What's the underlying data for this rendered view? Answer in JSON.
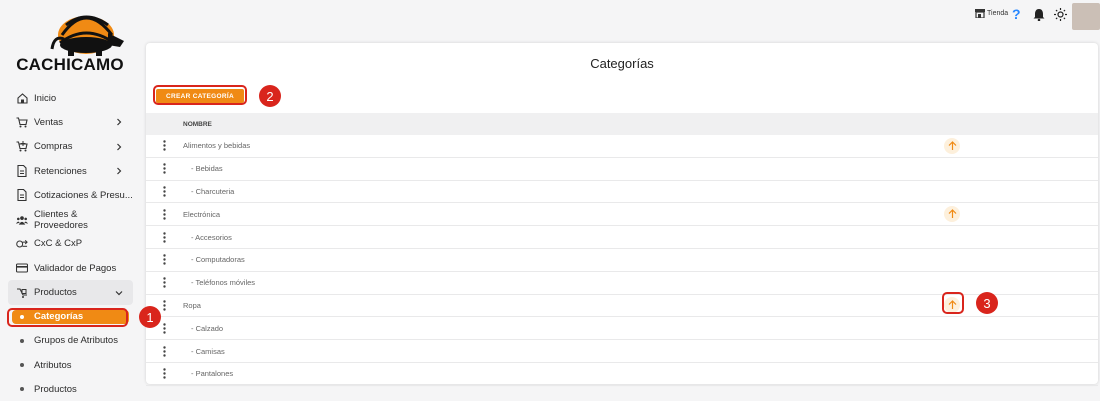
{
  "app": {
    "brand": "CACHICAMO"
  },
  "topbar": {
    "store_label": "Tienda",
    "help_label": "?"
  },
  "sidebar": {
    "items": [
      {
        "label": "Inicio",
        "icon": "home-icon",
        "has_chevron": false
      },
      {
        "label": "Ventas",
        "icon": "cart-icon",
        "has_chevron": true
      },
      {
        "label": "Compras",
        "icon": "cart-plus-icon",
        "has_chevron": true
      },
      {
        "label": "Retenciones",
        "icon": "document-icon",
        "has_chevron": true
      },
      {
        "label": "Cotizaciones & Presu...",
        "icon": "document-icon",
        "has_chevron": false
      },
      {
        "label": "Clientes & Proveedores",
        "icon": "users-icon",
        "has_chevron": false
      },
      {
        "label": "CxC & CxP",
        "icon": "exchange-icon",
        "has_chevron": false
      },
      {
        "label": "Validador de Pagos",
        "icon": "card-icon",
        "has_chevron": false
      },
      {
        "label": "Productos",
        "icon": "box-icon",
        "has_chevron": true
      }
    ],
    "subitems": [
      {
        "label": "Categorías",
        "active": true
      },
      {
        "label": "Grupos de Atributos",
        "active": false
      },
      {
        "label": "Atributos",
        "active": false
      },
      {
        "label": "Productos",
        "active": false
      }
    ]
  },
  "main": {
    "title": "Categorías",
    "create_button": "CREAR CATEGORÍA",
    "column_header": "NOMBRE",
    "rows": [
      {
        "name": "Alimentos y bebidas",
        "child": false,
        "up": true
      },
      {
        "name": "- Bebidas",
        "child": true,
        "up": false
      },
      {
        "name": "- Charcuteria",
        "child": true,
        "up": false
      },
      {
        "name": "Electrónica",
        "child": false,
        "up": true
      },
      {
        "name": "- Accesorios",
        "child": true,
        "up": false
      },
      {
        "name": "- Computadoras",
        "child": true,
        "up": false
      },
      {
        "name": "- Teléfonos móviles",
        "child": true,
        "up": false
      },
      {
        "name": "Ropa",
        "child": false,
        "up": true
      },
      {
        "name": "- Calzado",
        "child": true,
        "up": false
      },
      {
        "name": "- Camisas",
        "child": true,
        "up": false
      },
      {
        "name": "- Pantalones",
        "child": true,
        "up": false
      }
    ]
  },
  "annotations": [
    "1",
    "2",
    "3"
  ],
  "colors": {
    "accent": "#f08a14",
    "annotation": "#d9251c",
    "up_bg": "#fdf0dc"
  }
}
